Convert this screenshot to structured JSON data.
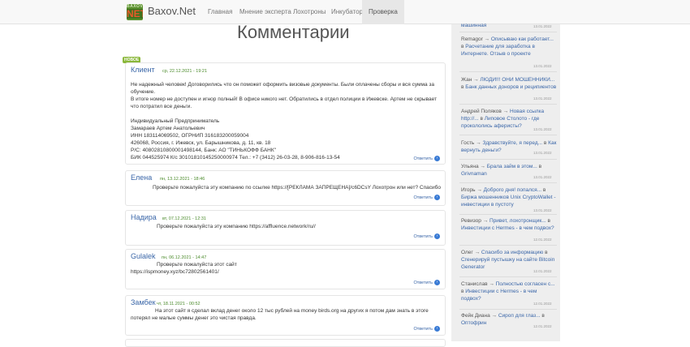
{
  "nav": {
    "logo_top": "BAXOV",
    "logo_bottom": "NET",
    "brand": "Baxov.Net",
    "items": [
      "Главная",
      "Мнение эксперта",
      "Лохотроны",
      "Инкубатор",
      "Проверка"
    ],
    "active": "Проверка"
  },
  "main": {
    "title": "Комментарии",
    "new_badge": "НОВОЕ",
    "reply_label": "Ответить",
    "comments": [
      {
        "author": "Клиент",
        "date": "ср, 22.12.2021 - 19:21",
        "text": "Не надежный человек! Договорились что он поможет оформить визовые документы. Были оплачены сборы и вся сумма за обучение.\nВ итоге номер не доступен и игнор полный! В офисе никого нет. Обратились в отдел полиции в Ижевске. Артем не скрывает что потратил все деньги.\n\nИндивидуальный Предприниматель\nЗамараев Артем Анатольевич\nИНН 183114069502, ОГРНИП 316183200059004\n426068, Россия, г. Ижевск, ул. Барышникова, д. 11, кв. 18\nР/С: 40802810800001498144, Банк: АО \"ТИНЬКОФФ БАНК\"\nБИК 044525974 К/с 30101810145250000974 Тел.: +7 (3412) 26-03-28, 8-906-816-13-54"
      },
      {
        "author": "Елена",
        "date": "пн, 13.12.2021 - 18:46",
        "text": "Проверьте пожалуйста эту компанию по ссылке https://[РЕКЛАМА ЗАПРЕЩЕНА]/c6DCsY Лохотрон или нет? Спасибо"
      },
      {
        "author": "Надира",
        "date": "вт, 07.12.2021 - 12:31",
        "text": "Проверьте пожалуйста эту компанию https://affluence.network/ru//"
      },
      {
        "author": "Gulalek",
        "date": "пн, 06.12.2021 - 14:47",
        "text": "Проверьте пожалуйста этот сайт\nhttps://ispmoney.xyz/bc72802561401/"
      },
      {
        "author": "Замбек",
        "date": "чт, 18.11.2021 - 00:52",
        "text": "На этот сайт я сделал вклад денег около 12 тыс рублей на money birds.org на других я потом дам знать в этоге потерял не малые суммы денег это чистая правда."
      }
    ]
  },
  "sidebar": {
    "items": [
      {
        "name": "",
        "arrow": "",
        "link": "машинная",
        "tail": "",
        "date": "13.01.2022"
      },
      {
        "name": "Remagor",
        "arrow": "→",
        "link": "Описываю как работает...",
        "tail": " в ",
        "link2": "Расчетание для заработка в Интернете. Отзыв о проекте",
        "date": "13.01.2022"
      },
      {
        "name": "Жан",
        "arrow": "→",
        "link": "ЛЮДИ!!! ОНИ МОШЕННИКИ...",
        "tail": " в ",
        "link2": "Банк данных доноров и реципиентов",
        "date": "13.01.2022"
      },
      {
        "name": "Андрей Поляков",
        "arrow": "→",
        "link": "Новая ссылка http://...",
        "tail": " в ",
        "link2": "Липовое Столото - где прокололись аферисты?",
        "date": "13.01.2022"
      },
      {
        "name": "Гость",
        "arrow": "→",
        "link": "Здравствуйте, я перед...",
        "tail": " в ",
        "link2": "Как вернуть деньги?",
        "date": "13.01.2022"
      },
      {
        "name": "Ульяна",
        "arrow": "→",
        "link": "Брала займ в этом...",
        "tail": " в ",
        "link2": "Grivnaman",
        "date": "13.01.2022"
      },
      {
        "name": "Игорь",
        "arrow": "→",
        "link": "Доброго дня! попался...",
        "tail": " в ",
        "link2": "Биржа мошенников Unix CryptoWallet - инвестиции в пустоту",
        "date": "13.01.2022"
      },
      {
        "name": "Ревизор",
        "arrow": "→",
        "link": "Привет, лохотронщик...",
        "tail": " в ",
        "link2": "Инвестиции с Hermes - в чем подвох?",
        "date": "12.01.2022"
      },
      {
        "name": "Олег",
        "arrow": "→",
        "link": "Спасибо за информацию",
        "tail": " в ",
        "link2": "Сгенерируй пустышку на сайте Bitcoin Generator",
        "date": "12.01.2022"
      },
      {
        "name": "Станислав",
        "arrow": "→",
        "link": "Полностью согласен с...",
        "tail": " в ",
        "link2": "Инвестиции с Hermes - в чем подвох?",
        "date": "12.01.2022"
      },
      {
        "name": "Фейк Диана",
        "arrow": "→",
        "link": "Сироп для глаз...",
        "tail": " в ",
        "link2": "Оптофрин",
        "date": "12.01.2022"
      }
    ]
  }
}
